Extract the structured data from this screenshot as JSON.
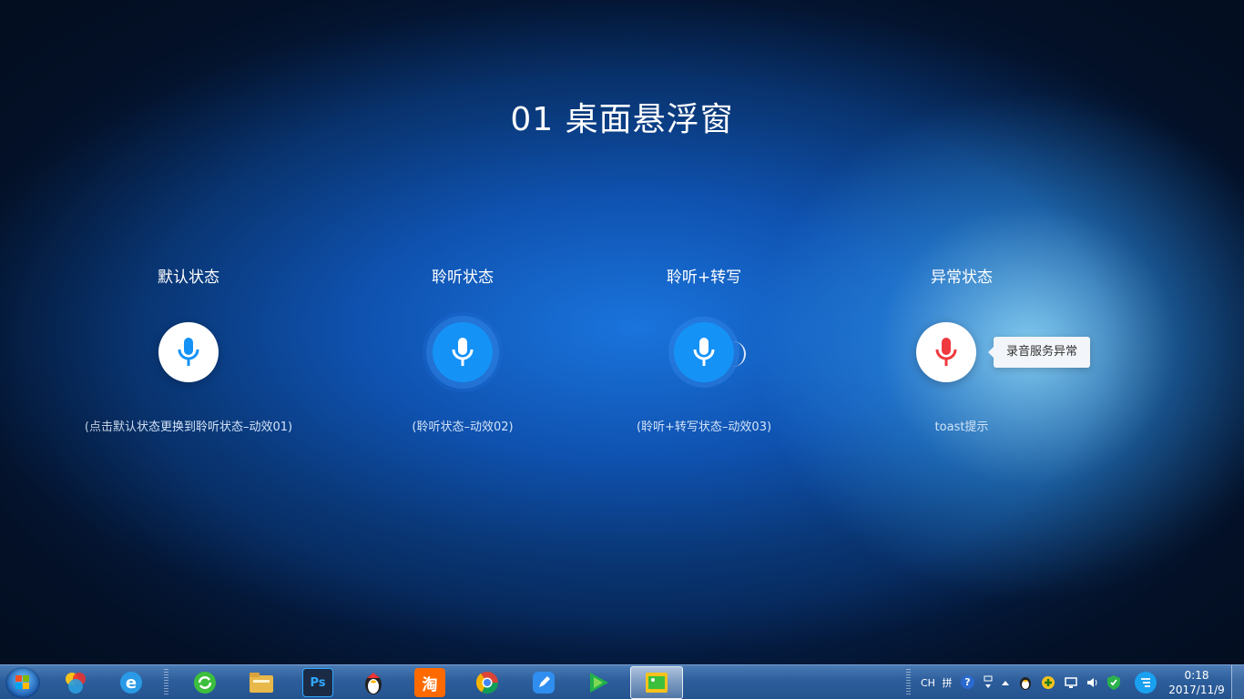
{
  "page": {
    "title": "01 桌面悬浮窗"
  },
  "states": [
    {
      "label": "默认状态",
      "caption": "(点击默认状态更换到聆听状态–动效01)"
    },
    {
      "label": "聆听状态",
      "caption": "(聆听状态–动效02)"
    },
    {
      "label": "聆听+转写",
      "caption": "(聆听+转写状态–动效03)"
    },
    {
      "label": "异常状态",
      "caption": "toast提示",
      "toast": "录音服务异常"
    }
  ],
  "colors": {
    "mic_blue": "#1592f6",
    "mic_red": "#f0383f",
    "toast_bg": "#f2f5f9"
  },
  "taskbar": {
    "pinned_icons": [
      "360-icon",
      "ie-icon",
      "refresh-app-icon",
      "file-explorer-icon",
      "photoshop-icon",
      "qq-penguin-icon",
      "taobao-icon",
      "chrome-icon",
      "edit-app-icon",
      "video-player-icon",
      "image-viewer-icon"
    ],
    "photoshop_label": "Ps",
    "taobao_label": "淘",
    "tray": {
      "lang": "CH",
      "ime": "拼",
      "help": "?"
    },
    "clock": {
      "time": "0:18",
      "date": "2017/11/9"
    }
  }
}
